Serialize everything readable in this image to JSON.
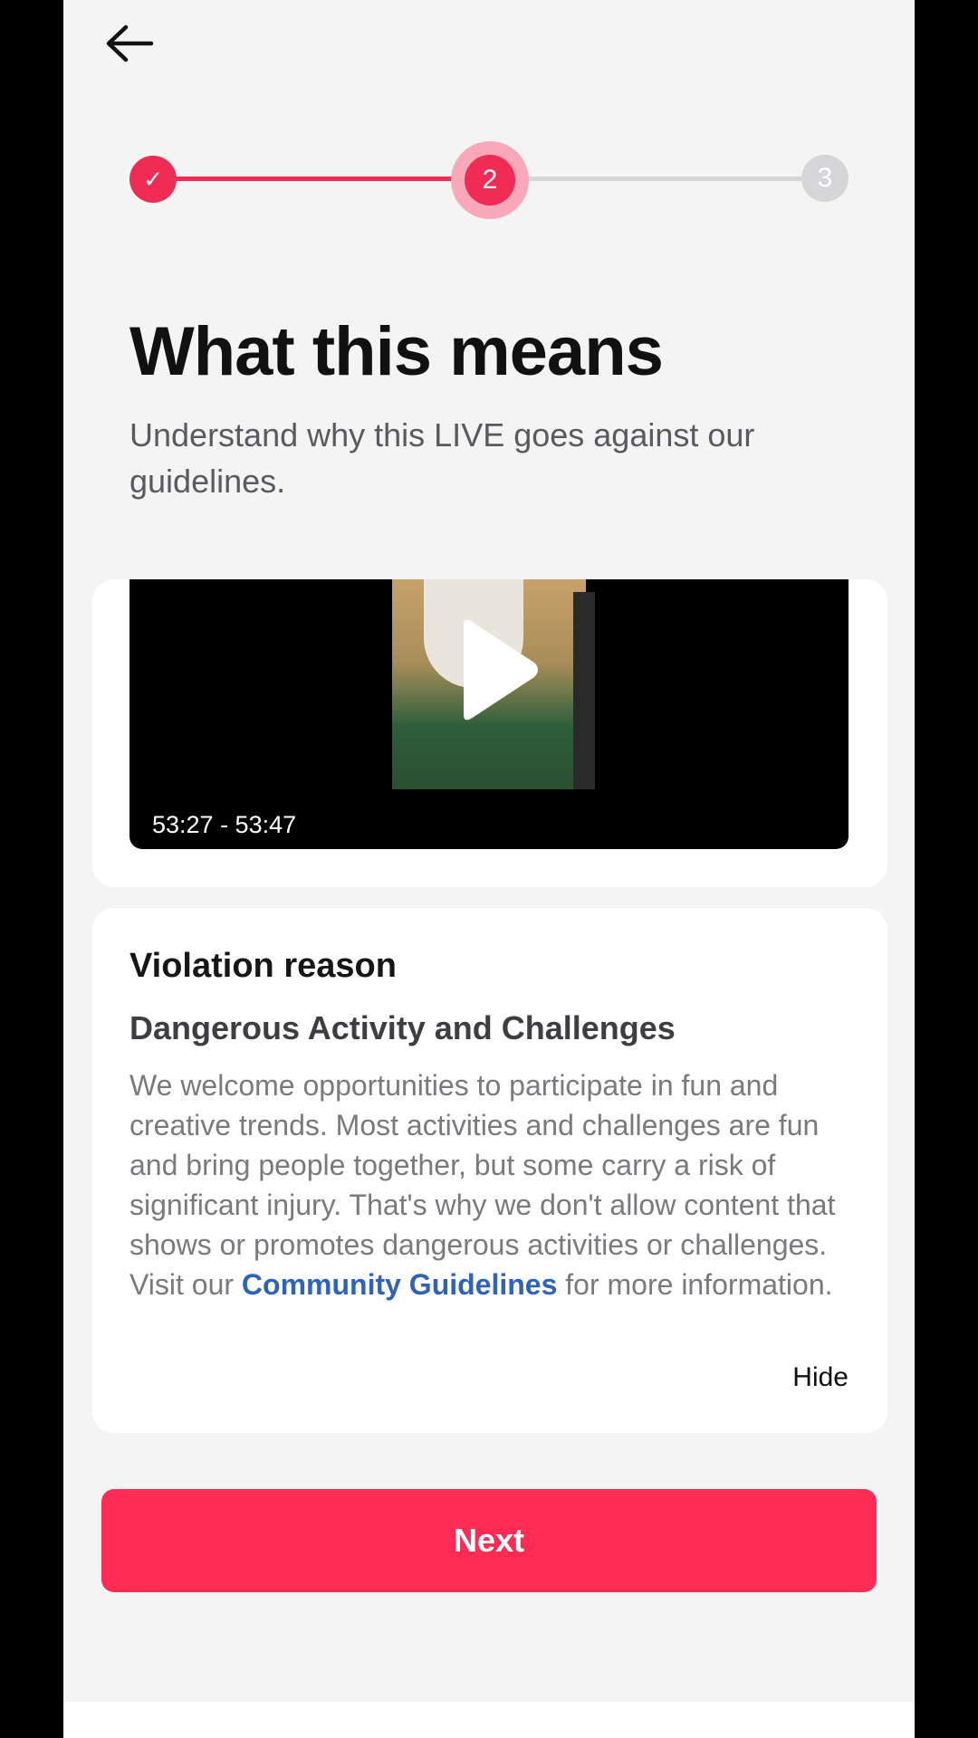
{
  "nav": {
    "back_icon": "arrow-left-icon"
  },
  "stepper": {
    "steps": [
      {
        "label": "✓",
        "state": "done",
        "icon": "check-icon"
      },
      {
        "label": "2",
        "state": "current"
      },
      {
        "label": "3",
        "state": "upcoming"
      }
    ],
    "accent_color": "#f02c55",
    "inactive_color": "#d6d6d8"
  },
  "header": {
    "title": "What this means",
    "subtitle": "Understand why this LIVE goes against our guidelines."
  },
  "video": {
    "timecode": "53:27 - 53:47",
    "play_icon": "play-icon"
  },
  "violation": {
    "heading": "Violation reason",
    "reason": "Dangerous Activity and Challenges",
    "body": "We welcome opportunities to participate in fun and creative trends. Most activities and challenges are fun and bring people together, but some carry a risk of significant injury. That's why we don't allow content that shows or promotes dangerous activities or challenges. Visit our",
    "link_text": "Community Guidelines",
    "body_suffix": "for more information.",
    "link_color": "#2e63b8",
    "hide_label": "Hide"
  },
  "actions": {
    "next_label": "Next",
    "button_color": "#fe2c55"
  }
}
